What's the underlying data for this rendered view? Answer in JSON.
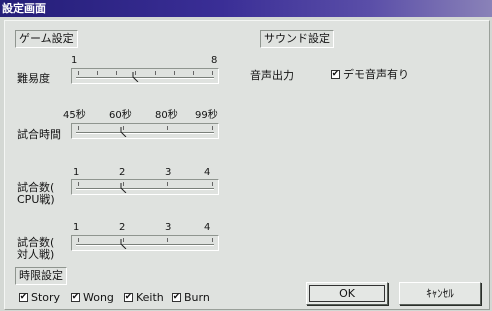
{
  "window": {
    "title": "設定画面"
  },
  "groups": {
    "game": "ゲーム設定",
    "sound": "サウンド設定",
    "time_limit": "時限設定"
  },
  "difficulty": {
    "label": "難易度",
    "min_label": "1",
    "max_label": "8",
    "value": 4,
    "min": 1,
    "max": 8
  },
  "match_time": {
    "label": "試合時間",
    "options": [
      "45秒",
      "60秒",
      "80秒",
      "99秒"
    ],
    "selected": "60秒"
  },
  "cpu_matches": {
    "label_line1": "試合数(",
    "label_line2": "CPU戦)",
    "options": [
      "1",
      "2",
      "3",
      "4"
    ],
    "selected": "2"
  },
  "vs_matches": {
    "label_line1": "試合数(",
    "label_line2": "対人戦)",
    "options": [
      "1",
      "2",
      "3",
      "4"
    ],
    "selected": "2"
  },
  "sound": {
    "output_label": "音声出力",
    "demo_sound_label": "デモ音声有り",
    "demo_sound_checked": true
  },
  "characters": [
    {
      "label": "Story",
      "checked": true
    },
    {
      "label": "Wong",
      "checked": true
    },
    {
      "label": "Keith",
      "checked": true
    },
    {
      "label": "Burn",
      "checked": true
    }
  ],
  "buttons": {
    "ok": "OK",
    "cancel": "ｷｬﾝｾﾙ"
  },
  "icons": {
    "check": "check-mark-icon",
    "thumb": "slider-thumb-icon"
  }
}
